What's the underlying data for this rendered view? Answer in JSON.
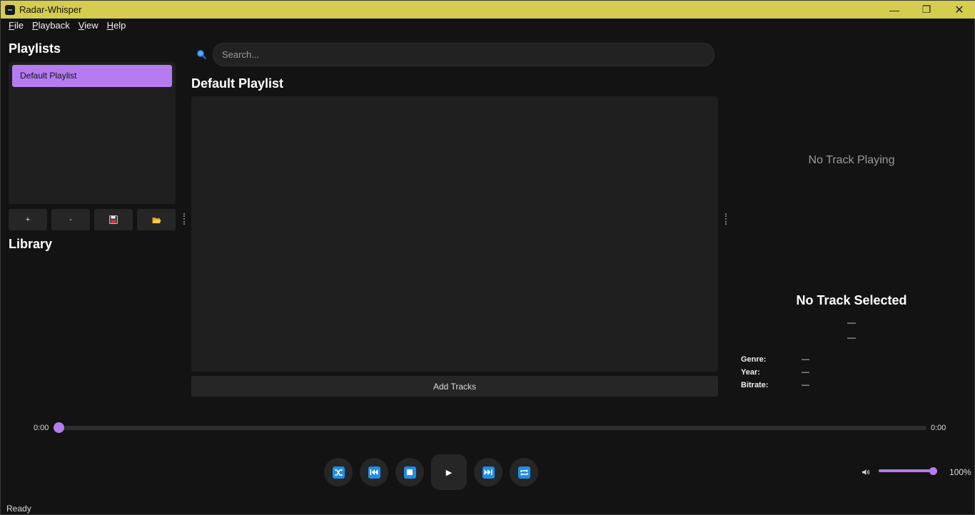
{
  "window": {
    "title": "Radar-Whisper",
    "minimize": "—",
    "maximize": "❐",
    "close": "✕"
  },
  "menu": [
    {
      "accel": "F",
      "rest": "ile"
    },
    {
      "accel": "P",
      "rest": "layback"
    },
    {
      "accel": "V",
      "rest": "iew"
    },
    {
      "accel": "H",
      "rest": "elp"
    }
  ],
  "sidebar": {
    "playlists_heading": "Playlists",
    "playlists": [
      "Default Playlist"
    ],
    "add_label": "+",
    "remove_label": "-",
    "save_icon": "floppy-disk-icon",
    "open_icon": "folder-icon",
    "library_heading": "Library"
  },
  "search": {
    "placeholder": "Search...",
    "value": ""
  },
  "main": {
    "playlist_title": "Default Playlist",
    "add_tracks_label": "Add Tracks"
  },
  "now_playing": {
    "status": "No Track Playing",
    "track_title": "No Track Selected",
    "artist": "—",
    "album": "—",
    "genre_label": "Genre:",
    "genre_value": "—",
    "year_label": "Year:",
    "year_value": "—",
    "bitrate_label": "Bitrate:",
    "bitrate_value": "—"
  },
  "progress": {
    "current": "0:00",
    "total": "0:00",
    "fraction": 0
  },
  "controls": {
    "shuffle_icon": "shuffle-icon",
    "prev_icon": "previous-icon",
    "stop_icon": "stop-icon",
    "play_label": "▶",
    "next_icon": "next-icon",
    "repeat_icon": "repeat-icon"
  },
  "volume": {
    "label": "100%",
    "fraction": 1.0
  },
  "statusbar": {
    "text": "Ready"
  },
  "colors": {
    "accent": "#b57cf0",
    "titlebar": "#d5cd4f",
    "control_blue": "#1e8ee6"
  }
}
